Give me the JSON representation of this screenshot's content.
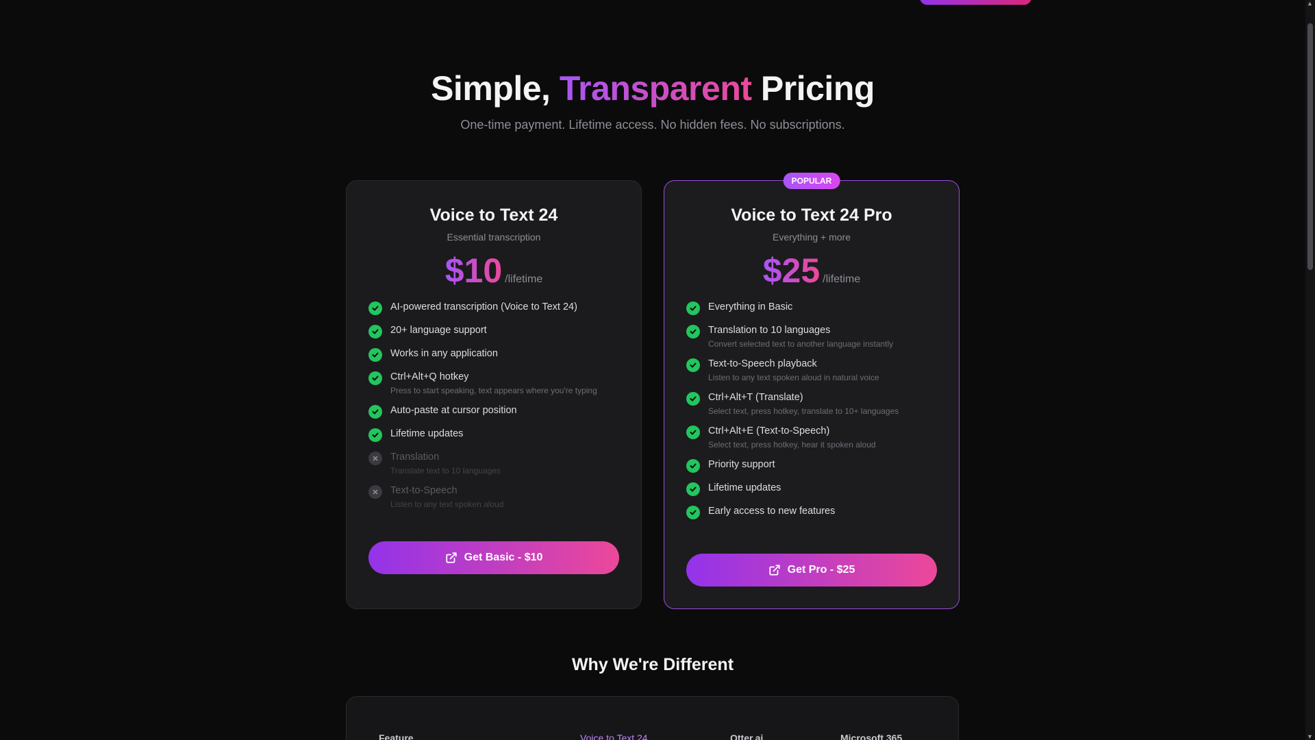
{
  "hero": {
    "title_part1": "Simple, ",
    "title_highlight": "Transparent",
    "title_part2": " Pricing",
    "subtitle": "One-time payment. Lifetime access. No hidden fees. No subscriptions."
  },
  "plans": [
    {
      "name": "Voice to Text 24",
      "subtitle": "Essential transcription",
      "price": "$10",
      "period": "/lifetime",
      "cta": "Get Basic - $10",
      "features": [
        {
          "label": "AI-powered transcription (Voice to Text 24)",
          "included": true
        },
        {
          "label": "20+ language support",
          "included": true
        },
        {
          "label": "Works in any application",
          "included": true
        },
        {
          "label": "Ctrl+Alt+Q hotkey",
          "desc": "Press to start speaking, text appears where you're typing",
          "included": true
        },
        {
          "label": "Auto-paste at cursor position",
          "included": true
        },
        {
          "label": "Lifetime updates",
          "included": true
        },
        {
          "label": "Translation",
          "desc": "Translate text to 10 languages",
          "included": false
        },
        {
          "label": "Text-to-Speech",
          "desc": "Listen to any text spoken aloud",
          "included": false
        }
      ]
    },
    {
      "badge": "POPULAR",
      "name": "Voice to Text 24 Pro",
      "subtitle": "Everything + more",
      "price": "$25",
      "period": "/lifetime",
      "cta": "Get Pro - $25",
      "features": [
        {
          "label": "Everything in Basic",
          "included": true
        },
        {
          "label": "Translation to 10 languages",
          "desc": "Convert selected text to another language instantly",
          "included": true
        },
        {
          "label": "Text-to-Speech playback",
          "desc": "Listen to any text spoken aloud in natural voice",
          "included": true
        },
        {
          "label": "Ctrl+Alt+T (Translate)",
          "desc": "Select text, press hotkey, translate to 10+ languages",
          "included": true
        },
        {
          "label": "Ctrl+Alt+E (Text-to-Speech)",
          "desc": "Select text, press hotkey, hear it spoken aloud",
          "included": true
        },
        {
          "label": "Priority support",
          "included": true
        },
        {
          "label": "Lifetime updates",
          "included": true
        },
        {
          "label": "Early access to new features",
          "included": true
        }
      ]
    }
  ],
  "comparison": {
    "title": "Why We're Different",
    "columns": [
      "Feature",
      "Voice to Text 24",
      "Otter.ai",
      "Microsoft 365"
    ]
  },
  "colors": {
    "accent_start": "#a855f7",
    "accent_end": "#ec4899",
    "check": "#22c55e",
    "background": "#0b0b0c"
  },
  "icons": {
    "included": "check-circle-icon",
    "excluded": "x-circle-icon",
    "cta": "external-link-icon"
  }
}
